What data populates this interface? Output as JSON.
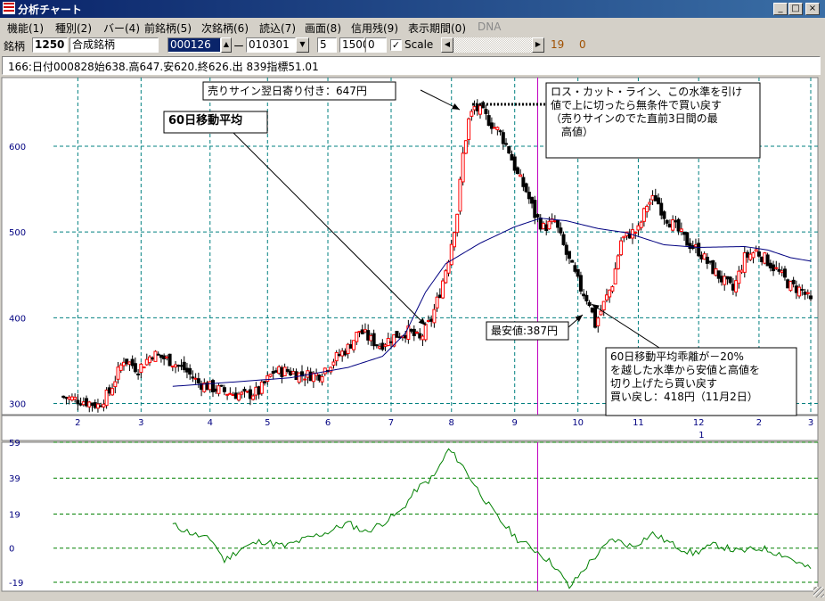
{
  "window": {
    "title": "分析チャート",
    "buttons": {
      "minimize": "_",
      "maximize": "□",
      "close": "×"
    }
  },
  "menu": [
    {
      "label": "機能(1)"
    },
    {
      "label": "種別(2)"
    },
    {
      "label": "バー(4)"
    },
    {
      "label": "前銘柄(5)"
    },
    {
      "label": "次銘柄(6)"
    },
    {
      "label": "読込(7)"
    },
    {
      "label": "画面(8)"
    },
    {
      "label": "信用残(9)"
    },
    {
      "label": "表示期間(0)"
    },
    {
      "label": "DNA",
      "disabled": true
    }
  ],
  "toolbar": {
    "code_label": "銘柄",
    "code": "1250",
    "name": "合成銘柄",
    "start": "000126",
    "dash": "ー",
    "end": "010301",
    "field_a": "5",
    "field_b": "1500",
    "field_c": "0",
    "scale_label": "Scale",
    "scale_checked": true,
    "count_a": "19",
    "count_b": "0"
  },
  "info_line": "166:日付000828始638.高647.安620.終626.出 839指標51.01",
  "colors": {
    "up_candle": "#ff0000",
    "down_candle": "#000000",
    "ma_line": "#000080",
    "deviation_line": "#008000",
    "grid": "#008080",
    "cursor": "#c000c0"
  },
  "chart_data": [
    {
      "type": "candlestick",
      "title": "",
      "series": [
        {
          "name": "60日移動平均",
          "type": "line"
        }
      ],
      "y_ticks": [
        300,
        400,
        500,
        600
      ],
      "ylim": [
        287,
        680
      ],
      "x_ticks": [
        "2",
        "3",
        "4",
        "5",
        "6",
        "7",
        "8",
        "9",
        "10",
        "11",
        "12",
        "2",
        "3"
      ],
      "x_subticks": [
        "1"
      ],
      "grid": true,
      "annotations": [
        {
          "text": "売りサイン翌日寄り付き：647円",
          "value": 647
        },
        {
          "text": "60日移動平均"
        },
        {
          "text": "ロス・カット・ライン、この水準を引け値で上に切ったら無条件で買い戻す（売りサインのでた直前3日間の最高値）"
        },
        {
          "text": "最安値:387円",
          "value": 387
        },
        {
          "text": "60日移動平均乖離が－20%を越した水準から安値と高値を切り上げたら買い戻す 買い戻し：418円（11月2日）",
          "value": 418
        }
      ],
      "price_path": [
        [
          0,
          308
        ],
        [
          8,
          303
        ],
        [
          13,
          298
        ],
        [
          17,
          313
        ],
        [
          22,
          352
        ],
        [
          27,
          340
        ],
        [
          32,
          358
        ],
        [
          38,
          350
        ],
        [
          43,
          340
        ],
        [
          48,
          324
        ],
        [
          53,
          318
        ],
        [
          58,
          313
        ],
        [
          64,
          309
        ],
        [
          69,
          314
        ],
        [
          74,
          337
        ],
        [
          79,
          338
        ],
        [
          84,
          333
        ],
        [
          90,
          334
        ],
        [
          95,
          351
        ],
        [
          100,
          365
        ],
        [
          104,
          385
        ],
        [
          108,
          374
        ],
        [
          111,
          368
        ],
        [
          113,
          372
        ],
        [
          117,
          380
        ],
        [
          121,
          384
        ],
        [
          125,
          374
        ],
        [
          129,
          398
        ],
        [
          132,
          430
        ],
        [
          135,
          470
        ],
        [
          138,
          523
        ],
        [
          140,
          590
        ],
        [
          142,
          630
        ],
        [
          144,
          645
        ],
        [
          147,
          638
        ],
        [
          150,
          626
        ],
        [
          153,
          615
        ],
        [
          156,
          595
        ],
        [
          159,
          566
        ],
        [
          162,
          548
        ],
        [
          165,
          520
        ],
        [
          168,
          505
        ],
        [
          172,
          512
        ],
        [
          176,
          474
        ],
        [
          181,
          434
        ],
        [
          184,
          418
        ],
        [
          186,
          392
        ],
        [
          189,
          416
        ],
        [
          192,
          440
        ],
        [
          195,
          490
        ],
        [
          198,
          498
        ],
        [
          201,
          502
        ],
        [
          204,
          532
        ],
        [
          207,
          540
        ],
        [
          210,
          520
        ],
        [
          214,
          505
        ],
        [
          218,
          488
        ],
        [
          222,
          478
        ],
        [
          226,
          460
        ],
        [
          230,
          445
        ],
        [
          234,
          432
        ],
        [
          238,
          470
        ],
        [
          242,
          478
        ],
        [
          246,
          466
        ],
        [
          250,
          452
        ],
        [
          254,
          437
        ],
        [
          258,
          432
        ],
        [
          261,
          418
        ]
      ],
      "ma_path": [
        [
          39,
          320
        ],
        [
          60,
          325
        ],
        [
          80,
          330
        ],
        [
          100,
          342
        ],
        [
          112,
          355
        ],
        [
          120,
          382
        ],
        [
          127,
          430
        ],
        [
          134,
          463
        ],
        [
          146,
          487
        ],
        [
          158,
          506
        ],
        [
          167,
          516
        ],
        [
          176,
          513
        ],
        [
          187,
          504
        ],
        [
          197,
          499
        ],
        [
          210,
          485
        ],
        [
          222,
          482
        ],
        [
          238,
          483
        ],
        [
          246,
          479
        ],
        [
          254,
          470
        ],
        [
          261,
          466
        ]
      ],
      "deviation": {
        "name": "60日移動平均乖離",
        "y_ticks": [
          -19,
          0,
          19,
          39,
          59
        ],
        "ylim": [
          -24,
          59
        ],
        "path": [
          [
            39,
            13
          ],
          [
            46,
            8
          ],
          [
            53,
            4
          ],
          [
            57,
            -7
          ],
          [
            63,
            0
          ],
          [
            70,
            4
          ],
          [
            78,
            1
          ],
          [
            85,
            5
          ],
          [
            93,
            9
          ],
          [
            100,
            14
          ],
          [
            106,
            9
          ],
          [
            112,
            14
          ],
          [
            118,
            20
          ],
          [
            124,
            33
          ],
          [
            130,
            40
          ],
          [
            135,
            55
          ],
          [
            139,
            48
          ],
          [
            145,
            33
          ],
          [
            152,
            17
          ],
          [
            159,
            5
          ],
          [
            166,
            -2
          ],
          [
            172,
            -10
          ],
          [
            177,
            -22
          ],
          [
            184,
            -8
          ],
          [
            192,
            5
          ],
          [
            199,
            1
          ],
          [
            206,
            8
          ],
          [
            213,
            2
          ],
          [
            220,
            -3
          ],
          [
            228,
            2
          ],
          [
            236,
            -2
          ],
          [
            244,
            0
          ],
          [
            252,
            -4
          ],
          [
            261,
            -12
          ]
        ]
      }
    }
  ]
}
